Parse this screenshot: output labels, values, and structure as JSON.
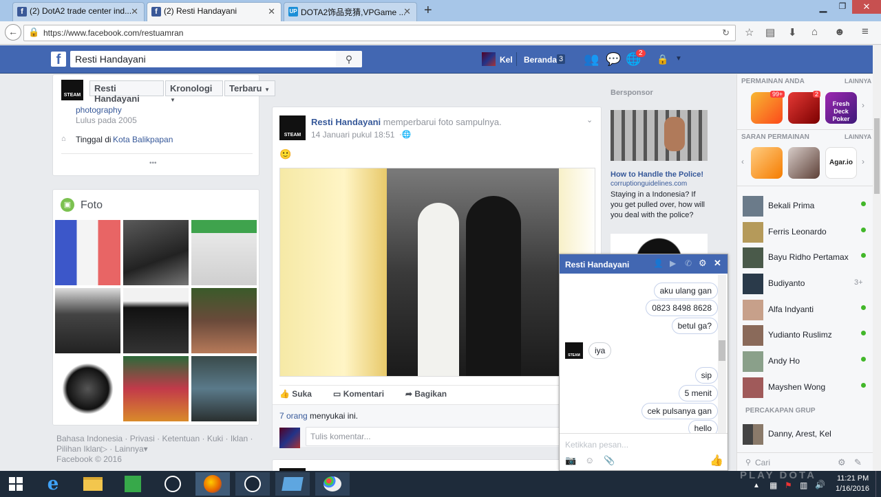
{
  "browser": {
    "tabs": [
      {
        "label": "(2) DotA2 trade center ind...",
        "icon": "f"
      },
      {
        "label": "(2) Resti Handayani",
        "icon": "f"
      },
      {
        "label": "DOTA2饰品竞猜,VPGame ...",
        "icon": "UP"
      }
    ],
    "url": "https://www.facebook.com/restuamran"
  },
  "fb_header": {
    "search_value": "Resti Handayani",
    "user_name": "Kel",
    "home_label": "Beranda",
    "home_count": "3",
    "notif_count": "2"
  },
  "profile_bar": {
    "name_button": "Resti Handayani",
    "timeline_button": "Kronologi",
    "recent_button": "Terbaru"
  },
  "intro": {
    "study_link": "photography",
    "study_sub": "Lulus pada 2005",
    "lives_prefix": "Tinggal di",
    "lives_link": "Kota Balikpapan",
    "more": "•••"
  },
  "photos": {
    "title": "Foto"
  },
  "footer": {
    "lang": "Bahasa Indonesia",
    "privacy": "Privasi",
    "terms": "Ketentuan",
    "cookies": "Kuki",
    "ads": "Iklan",
    "adchoice": "Pilihan Iklan",
    "more": "Lainnya",
    "copyright": "Facebook © 2016"
  },
  "post": {
    "author": "Resti Handayani",
    "action": "memperbarui foto sampulnya.",
    "timestamp": "14 Januari pukul 18:51",
    "emoji": "🙂",
    "like_label": "Suka",
    "comment_label": "Komentari",
    "share_label": "Bagikan",
    "likes_count": "7 orang",
    "likes_suffix": "menyukai ini.",
    "comment_placeholder": "Tulis komentar..."
  },
  "sponsored": {
    "title": "Bersponsor",
    "ad_title": "How to Handle the Police!",
    "ad_domain": "corruptionguidelines.com",
    "ad_text": "Staying in a Indonesia? If you get pulled over, how will you deal with the police?"
  },
  "chat": {
    "title": "Resti Handayani",
    "messages": [
      {
        "text": "aku ulang gan",
        "from": "me"
      },
      {
        "text": "0823 8498 8628",
        "from": "me"
      },
      {
        "text": "betul ga?",
        "from": "me"
      },
      {
        "text": "iya",
        "from": "them"
      },
      {
        "text": "sip",
        "from": "me"
      },
      {
        "text": "5 menit",
        "from": "me"
      },
      {
        "text": "cek pulsanya gan",
        "from": "me"
      },
      {
        "text": "hello",
        "from": "me"
      }
    ],
    "input_placeholder": "Ketikkan pesan..."
  },
  "right_sidebar": {
    "games_title": "PERMAINAN ANDA",
    "games_more": "LAINNYA",
    "game_badges": [
      "99+",
      "2"
    ],
    "suggest_title": "SARAN PERMAINAN",
    "suggest_more": "LAINNYA",
    "game_tiles": [
      "Agar.io",
      "Fresh Deck Poker"
    ],
    "contacts": [
      {
        "name": "Bekali Prima",
        "status": "online"
      },
      {
        "name": "Ferris Leonardo",
        "status": "online"
      },
      {
        "name": "Bayu Ridho Pertamax",
        "status": "online"
      },
      {
        "name": "Budiyanto",
        "status": "3+"
      },
      {
        "name": "Alfa Indyanti",
        "status": "online"
      },
      {
        "name": "Yudianto Ruslimz",
        "status": "online"
      },
      {
        "name": "Andy Ho",
        "status": "online"
      },
      {
        "name": "Mayshen Wong",
        "status": "online"
      }
    ],
    "group_title": "PERCAKAPAN GRUP",
    "group_name": "Danny, Arest, Kel",
    "search_placeholder": "Cari"
  },
  "taskbar": {
    "time": "11:21 PM",
    "date": "1/16/2016",
    "watermark": "PLAY DOTA"
  }
}
